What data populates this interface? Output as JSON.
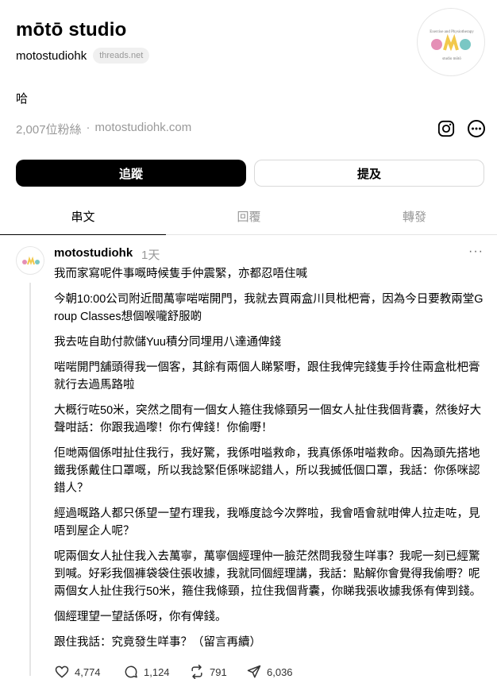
{
  "profile": {
    "display_name": "mōtō studio",
    "handle": "motostudiohk",
    "domain_chip": "threads.net",
    "bio": "哈",
    "followers": "2,007位粉絲",
    "separator": "·",
    "website": "motostudiohk.com",
    "avatar_logo_top": "Exercise and Physiotherapy",
    "avatar_logo_main": "MOVO",
    "avatar_logo_bottom": "studio mōtō"
  },
  "buttons": {
    "follow": "追蹤",
    "mention": "提及"
  },
  "tabs": [
    {
      "label": "串文",
      "active": true
    },
    {
      "label": "回覆",
      "active": false
    },
    {
      "label": "轉發",
      "active": false
    }
  ],
  "post": {
    "author": "motostudiohk",
    "time": "1天",
    "more": "···",
    "paragraphs": [
      "我而家寫呢件事嘅時候隻手仲震緊，亦都忍唔住喊",
      "今朝10:00公司附近間萬寧啱啱開門，我就去買兩盒川貝枇杷膏，因為今日要教兩堂Group Classes想個喉嚨舒服啲",
      "我去咗自助付款儲Yuu積分同埋用八達通俾錢",
      "啱啱開門舖頭得我一個客，其餘有兩個人睇緊嘢，跟住我俾完錢隻手拎住兩盒枇杷膏就行去過馬路啦",
      "大概行咗50米，突然之間有一個女人箍住我條頸另一個女人扯住我個背囊，然後好大聲咁話：你跟我過嚟！你冇俾錢！你偷嘢！",
      "佢哋兩個係咁扯住我行，我好驚，我係咁嗌救命，我真係係咁嗌救命。因為頭先搭地鐵我係戴住口罩嘅，所以我諗緊佢係咪認錯人，所以我搣低個口罩，我話：你係咪認錯人？",
      "經過嘅路人都只係望一望冇理我，我喺度諗今次弊啦，我會唔會就咁俾人拉走咗，見唔到屋企人呢？",
      "呢兩個女人扯住我入去萬寧，萬寧個經理仲一臉茫然問我發生咩事？我呢一刻已經驚到喊。好彩我個褲袋袋住張收據，我就同個經理講，我話：點解你會覺得我偷嘢？呢兩個女人扯住我行50米，箍住我條頸，拉住我個背囊，你睇我張收據我係有俾到錢。",
      "個經理望一望話係呀，你有俾錢。",
      "跟住我話：究竟發生咩事？（留言再續）"
    ],
    "stats": {
      "likes": "4,774",
      "comments": "1,124",
      "reposts": "791",
      "shares": "6,036"
    }
  },
  "colors": {
    "logo_pink": "#e58fb6",
    "logo_teal": "#7ac7c4",
    "logo_yellow": "#f2c94c",
    "logo_purple": "#a58fd6"
  }
}
